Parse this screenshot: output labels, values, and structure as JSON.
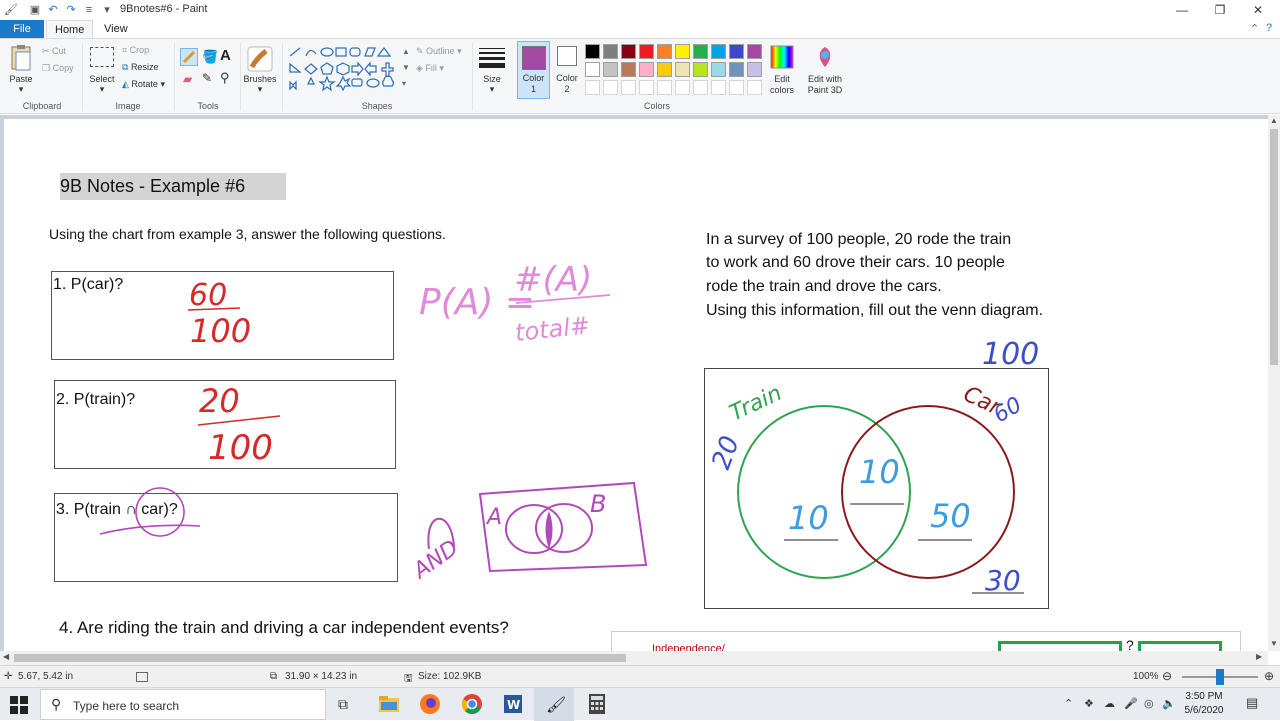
{
  "window": {
    "title": "9Bnotes#6 - Paint",
    "minimize_glyph": "—",
    "maximize_glyph": "❐",
    "close_glyph": "✕"
  },
  "ribbon_tabs": {
    "file": "File",
    "home": "Home",
    "view": "View"
  },
  "clipboard": {
    "paste": "Paste",
    "cut": "Cut",
    "copy": "Copy",
    "label": "Clipboard"
  },
  "image": {
    "crop": "Crop",
    "resize": "Resize",
    "rotate": "Rotate",
    "select": "Select",
    "label": "Image"
  },
  "tools": {
    "label": "Tools"
  },
  "brushes": {
    "label": "Brushes"
  },
  "shapes": {
    "outline": "Outline",
    "fill": "Fill",
    "label": "Shapes"
  },
  "size": {
    "label": "Size"
  },
  "colors": {
    "color1_label": "Color",
    "color1_num": "1",
    "color2_label": "Color",
    "color2_num": "2",
    "edit_colors_1": "Edit",
    "edit_colors_2": "colors",
    "paint3d_1": "Edit with",
    "paint3d_2": "Paint 3D",
    "label": "Colors",
    "color1_value": "#a349a4",
    "color2_value": "#ffffff",
    "palette_row1": [
      "#000000",
      "#7f7f7f",
      "#880015",
      "#ed1c24",
      "#ff7f27",
      "#fff200",
      "#22b14c",
      "#00a2e8",
      "#3f48cc",
      "#a349a4"
    ],
    "palette_row2": [
      "#ffffff",
      "#c3c3c3",
      "#b97a57",
      "#ffaec9",
      "#ffc90e",
      "#efe4b0",
      "#b5e61d",
      "#99d9ea",
      "#7092be",
      "#c8bfe7"
    ]
  },
  "document": {
    "heading": "9B Notes - Example #6",
    "instructions": "Using the chart from example 3, answer the following questions.",
    "q1": "1.    P(car)?",
    "q2": "2.    P(train)?",
    "q3": "3.    P(train ∩ car)?",
    "q4": "4.    Are riding the train and driving a car independent events?",
    "survey_line1": "In a survey of 100 people, 20 rode the train",
    "survey_line2": "to work  and 60 drove their cars. 10 people",
    "survey_line3": "rode the train and drove the cars.",
    "survey_line4": "Using this information, fill out the venn diagram.",
    "independence_partial": "Independence/",
    "question_mark": "?",
    "handwriting": {
      "q1_num": "60",
      "q1_den": "100",
      "q2_num": "20",
      "q2_den": "100",
      "formula_left": "P(A) =",
      "formula_num": "#(A)",
      "formula_den": "total#",
      "and_text": "AND",
      "box_a": "A",
      "box_b": "B",
      "total": "100",
      "train_label": "Train",
      "train_count": "20",
      "car_label": "Car",
      "car_count": "60",
      "train_only": "10",
      "both": "10",
      "car_only": "50",
      "neither": "30"
    }
  },
  "status": {
    "cursor_pos": "5.67, 5.42 in",
    "selection_size": "31.90 × 14.23 in",
    "file_size": "Size: 102.9KB",
    "zoom": "100%",
    "zoom_level": 0.5
  },
  "taskbar": {
    "search_placeholder": "Type here to search",
    "time": "3:50 PM",
    "date": "5/6/2020"
  }
}
